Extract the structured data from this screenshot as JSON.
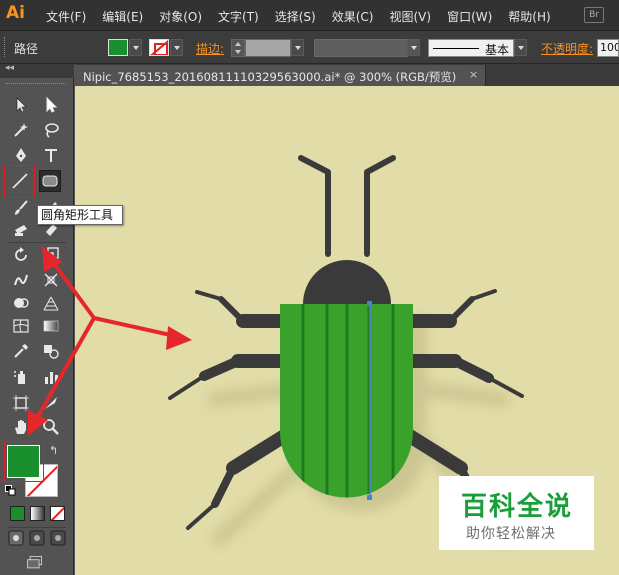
{
  "app": {
    "logo_text": "Ai",
    "menu": [
      "文件(F)",
      "编辑(E)",
      "对象(O)",
      "文字(T)",
      "选择(S)",
      "效果(C)",
      "视图(V)",
      "窗口(W)",
      "帮助(H)"
    ],
    "bridge_label": "Br"
  },
  "control_bar": {
    "selection_label": "路径",
    "fill_color": "#1a8f2e",
    "stroke_label": "描边:",
    "brush_profile": "基本",
    "opacity_label": "不透明度:",
    "opacity_value": "100"
  },
  "tools_panel": {
    "collapse_glyph": "◂◂",
    "fill_color": "#1a8f2e",
    "stroke_color": "#ffffff"
  },
  "tooltip": {
    "text": "圆角矩形工具"
  },
  "document": {
    "tab_title": "Nipic_7685153_20160811110329563000.ai* @ 300% (RGB/预览)",
    "close_glyph": "×",
    "canvas_color": "#e2dca8"
  },
  "artwork": {
    "body_color": "#3aa12b",
    "stripe_color": "#1f7a1e",
    "head_color": "#3a3a3a",
    "selection_color": "#4a7fd6"
  },
  "annotations": {
    "arrow_color": "#e5262a"
  },
  "watermark": {
    "title": "百科全说",
    "subtitle": "助你轻松解决"
  }
}
